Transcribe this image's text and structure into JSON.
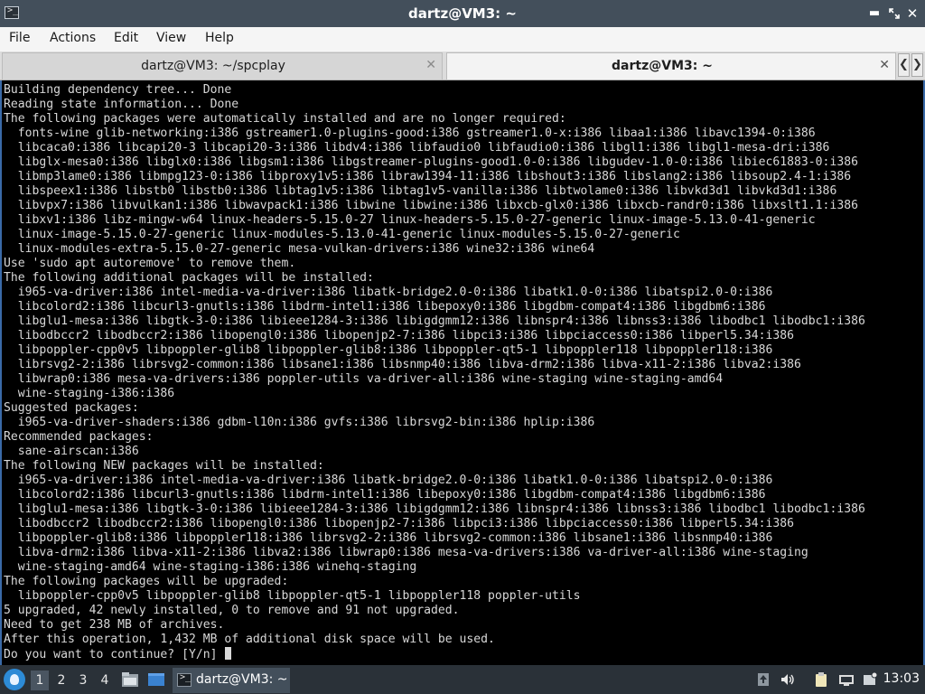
{
  "window": {
    "title": "dartz@VM3: ~",
    "icon": "terminal-icon"
  },
  "window_buttons": [
    "minimize-icon",
    "maximize-icon",
    "close-icon"
  ],
  "menu": [
    "File",
    "Actions",
    "Edit",
    "View",
    "Help"
  ],
  "tabs": [
    {
      "label": "dartz@VM3: ~/spcplay",
      "active": false
    },
    {
      "label": "dartz@VM3: ~",
      "active": true
    }
  ],
  "terminal": {
    "lines": [
      "Building dependency tree... Done",
      "Reading state information... Done",
      "The following packages were automatically installed and are no longer required:",
      "  fonts-wine glib-networking:i386 gstreamer1.0-plugins-good:i386 gstreamer1.0-x:i386 libaa1:i386 libavc1394-0:i386",
      "  libcaca0:i386 libcapi20-3 libcapi20-3:i386 libdv4:i386 libfaudio0 libfaudio0:i386 libgl1:i386 libgl1-mesa-dri:i386",
      "  libglx-mesa0:i386 libglx0:i386 libgsm1:i386 libgstreamer-plugins-good1.0-0:i386 libgudev-1.0-0:i386 libiec61883-0:i386",
      "  libmp3lame0:i386 libmpg123-0:i386 libproxy1v5:i386 libraw1394-11:i386 libshout3:i386 libslang2:i386 libsoup2.4-1:i386",
      "  libspeex1:i386 libstb0 libstb0:i386 libtag1v5:i386 libtag1v5-vanilla:i386 libtwolame0:i386 libvkd3d1 libvkd3d1:i386",
      "  libvpx7:i386 libvulkan1:i386 libwavpack1:i386 libwine libwine:i386 libxcb-glx0:i386 libxcb-randr0:i386 libxslt1.1:i386",
      "  libxv1:i386 libz-mingw-w64 linux-headers-5.15.0-27 linux-headers-5.15.0-27-generic linux-image-5.13.0-41-generic",
      "  linux-image-5.15.0-27-generic linux-modules-5.13.0-41-generic linux-modules-5.15.0-27-generic",
      "  linux-modules-extra-5.15.0-27-generic mesa-vulkan-drivers:i386 wine32:i386 wine64",
      "Use 'sudo apt autoremove' to remove them.",
      "The following additional packages will be installed:",
      "  i965-va-driver:i386 intel-media-va-driver:i386 libatk-bridge2.0-0:i386 libatk1.0-0:i386 libatspi2.0-0:i386",
      "  libcolord2:i386 libcurl3-gnutls:i386 libdrm-intel1:i386 libepoxy0:i386 libgdbm-compat4:i386 libgdbm6:i386",
      "  libglu1-mesa:i386 libgtk-3-0:i386 libieee1284-3:i386 libigdgmm12:i386 libnspr4:i386 libnss3:i386 libodbc1 libodbc1:i386",
      "  libodbccr2 libodbccr2:i386 libopengl0:i386 libopenjp2-7:i386 libpci3:i386 libpciaccess0:i386 libperl5.34:i386",
      "  libpoppler-cpp0v5 libpoppler-glib8 libpoppler-glib8:i386 libpoppler-qt5-1 libpoppler118 libpoppler118:i386",
      "  librsvg2-2:i386 librsvg2-common:i386 libsane1:i386 libsnmp40:i386 libva-drm2:i386 libva-x11-2:i386 libva2:i386",
      "  libwrap0:i386 mesa-va-drivers:i386 poppler-utils va-driver-all:i386 wine-staging wine-staging-amd64",
      "  wine-staging-i386:i386",
      "Suggested packages:",
      "  i965-va-driver-shaders:i386 gdbm-l10n:i386 gvfs:i386 librsvg2-bin:i386 hplip:i386",
      "Recommended packages:",
      "  sane-airscan:i386",
      "The following NEW packages will be installed:",
      "  i965-va-driver:i386 intel-media-va-driver:i386 libatk-bridge2.0-0:i386 libatk1.0-0:i386 libatspi2.0-0:i386",
      "  libcolord2:i386 libcurl3-gnutls:i386 libdrm-intel1:i386 libepoxy0:i386 libgdbm-compat4:i386 libgdbm6:i386",
      "  libglu1-mesa:i386 libgtk-3-0:i386 libieee1284-3:i386 libigdgmm12:i386 libnspr4:i386 libnss3:i386 libodbc1 libodbc1:i386",
      "  libodbccr2 libodbccr2:i386 libopengl0:i386 libopenjp2-7:i386 libpci3:i386 libpciaccess0:i386 libperl5.34:i386",
      "  libpoppler-glib8:i386 libpoppler118:i386 librsvg2-2:i386 librsvg2-common:i386 libsane1:i386 libsnmp40:i386",
      "  libva-drm2:i386 libva-x11-2:i386 libva2:i386 libwrap0:i386 mesa-va-drivers:i386 va-driver-all:i386 wine-staging",
      "  wine-staging-amd64 wine-staging-i386:i386 winehq-staging",
      "The following packages will be upgraded:",
      "  libpoppler-cpp0v5 libpoppler-glib8 libpoppler-qt5-1 libpoppler118 poppler-utils",
      "5 upgraded, 42 newly installed, 0 to remove and 91 not upgraded.",
      "Need to get 238 MB of archives.",
      "After this operation, 1,432 MB of additional disk space will be used.",
      "Do you want to continue? [Y/n] "
    ]
  },
  "taskbar": {
    "workspaces": [
      "1",
      "2",
      "3",
      "4"
    ],
    "active_workspace": "1",
    "task_label": "dartz@VM3: ~",
    "clock": "13:03",
    "launchers": [
      "file-manager-icon",
      "show-desktop-icon"
    ],
    "tray_icons": [
      "upload-icon",
      "volume-icon",
      "clipboard-icon",
      "network-icon",
      "notification-icon"
    ]
  },
  "colors": {
    "titlebar": "#434f5b",
    "taskbar": "#2a3138",
    "terminal_bg": "#000000",
    "terminal_fg": "#d8d8d8",
    "accent": "#3a6aa8"
  }
}
